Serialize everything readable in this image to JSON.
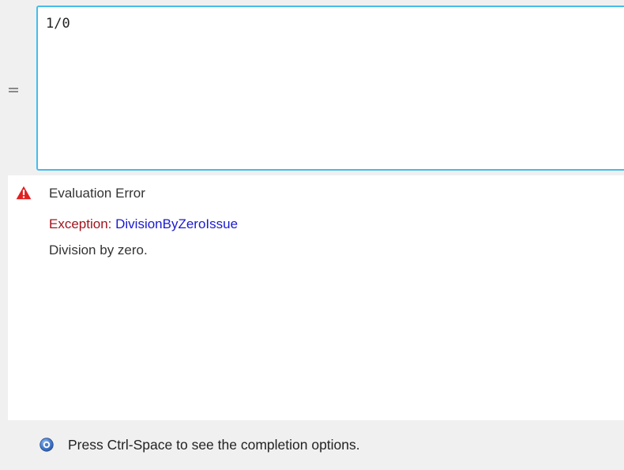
{
  "editor": {
    "expression": "1/0",
    "handle_icon": "equals-icon",
    "accent_color": "#44bdec"
  },
  "result": {
    "status_icon": "warning-triangle-icon",
    "title": "Evaluation Error",
    "exception_label": "Exception: ",
    "exception_type": "DivisionByZeroIssue",
    "message": "Division by zero.",
    "colors": {
      "icon": "#e02020",
      "exception_label": "#a0141e",
      "exception_link": "#1a1acf"
    }
  },
  "status_bar": {
    "icon": "help-icon",
    "text": "Press Ctrl-Space to see the completion options."
  }
}
